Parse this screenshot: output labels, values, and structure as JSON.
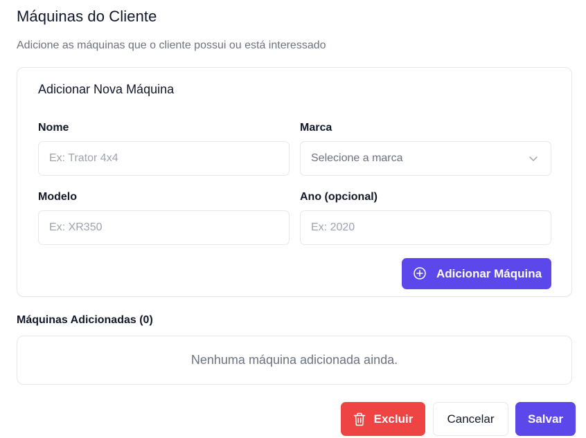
{
  "header": {
    "title": "Máquinas do Cliente",
    "subtitle": "Adicione as máquinas que o cliente possui ou está interessado"
  },
  "form": {
    "title": "Adicionar Nova Máquina",
    "nome": {
      "label": "Nome",
      "value": "",
      "placeholder": "Ex: Trator 4x4"
    },
    "marca": {
      "label": "Marca",
      "selected": "Selecione a marca",
      "icon": "chevron-down-icon"
    },
    "modelo": {
      "label": "Modelo",
      "value": "",
      "placeholder": "Ex: XR350"
    },
    "ano": {
      "label": "Ano (opcional)",
      "value": "",
      "placeholder": "Ex: 2020"
    },
    "add_button": {
      "label": "Adicionar Máquina",
      "icon": "plus-circle-icon"
    }
  },
  "added": {
    "title": "Máquinas Adicionadas (0)",
    "empty_text": "Nenhuma máquina adicionada ainda."
  },
  "actions": {
    "delete": {
      "label": "Excluir",
      "icon": "trash-icon"
    },
    "cancel": {
      "label": "Cancelar"
    },
    "save": {
      "label": "Salvar"
    }
  },
  "colors": {
    "primary": "#5b47ea",
    "danger": "#ef4444",
    "border": "#e5e7eb",
    "muted_text": "#6b7280"
  }
}
